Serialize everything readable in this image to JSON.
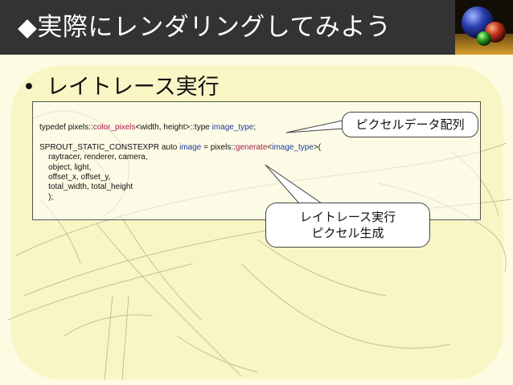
{
  "slide": {
    "title": "◆実際にレンダリングしてみよう",
    "bullet_marker": "•",
    "bullet_text": "レイトレース実行"
  },
  "code": {
    "line1": {
      "a": "typedef pixels::",
      "b": "color_pixels",
      "c": "<width, height>::type ",
      "d": "image_type",
      "e": ";"
    },
    "line2": {
      "a": "SPROUT_STATIC_CONSTEXPR auto ",
      "b": "image",
      "c": " = pixels::",
      "d": "generate",
      "e": "<",
      "f": "image_type",
      "g": ">("
    },
    "line3": "    raytracer, renderer, camera,",
    "line4": "    object, light,",
    "line5": "    offset_x, offset_y,",
    "line6": "    total_width, total_height",
    "line7": "    );"
  },
  "callouts": {
    "pixel_array": "ピクセルデータ配列",
    "raytrace_line1": "レイトレース実行",
    "raytrace_line2": "ピクセル生成"
  },
  "colors": {
    "header_bg": "#333333",
    "slide_bg": "#fdfbe1",
    "panel_bg": "#f9f6c5",
    "keyword_red": "#a8174a",
    "identifier_blue": "#1f3c9c"
  }
}
